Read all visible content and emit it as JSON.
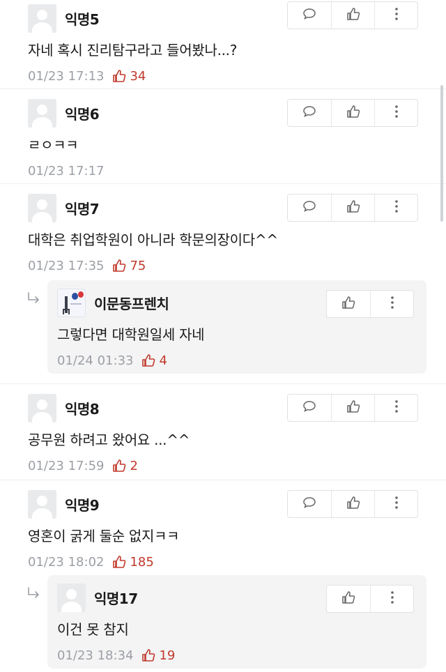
{
  "comments": [
    {
      "nick": "익명5",
      "body": "자네 혹시 진리탐구라고 들어봤나...?",
      "time": "01/23 17:13",
      "likes": "34"
    },
    {
      "nick": "익명6",
      "body": "ㄹㅇㅋㅋ",
      "time": "01/23 17:17",
      "likes": ""
    },
    {
      "nick": "익명7",
      "body": "대학은 취업학원이 아니라 학문의장이다^^",
      "time": "01/23 17:35",
      "likes": "75",
      "reply": {
        "nick": "이문동프렌치",
        "body": "그렇다면 대학원일세 자네",
        "time": "01/24 01:33",
        "likes": "4"
      }
    },
    {
      "nick": "익명8",
      "body": "공무원 하려고 왔어요 ...^^",
      "time": "01/23 17:59",
      "likes": "2"
    },
    {
      "nick": "익명9",
      "body": "영혼이 굵게 둘순 없지ㅋㅋ",
      "time": "01/23 18:02",
      "likes": "185",
      "reply": {
        "nick": "익명17",
        "body": "이건 못 참지",
        "time": "01/23 18:34",
        "likes": "19"
      }
    }
  ],
  "icons": {
    "comment": "speech-bubble-icon",
    "like": "thumbs-up-icon",
    "more": "vertical-dots-icon",
    "reply": "reply-arrow-icon"
  },
  "colors": {
    "like": "#c0392b",
    "meta": "#9b9fa5",
    "reply_bg": "#f4f4f5"
  }
}
